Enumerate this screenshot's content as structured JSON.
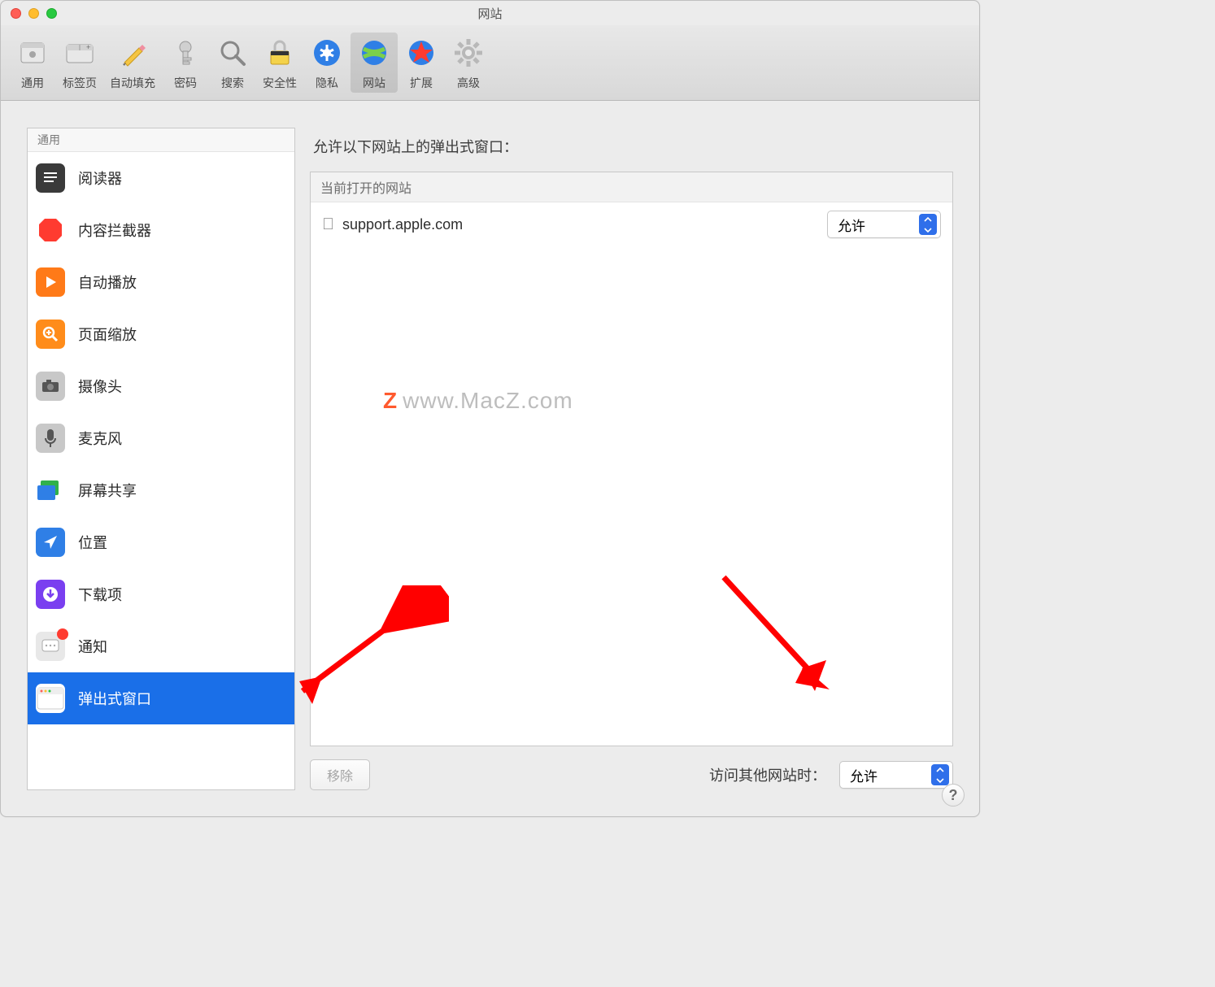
{
  "window": {
    "title": "网站"
  },
  "toolbar": {
    "items": [
      {
        "label": "通用",
        "icon": "general"
      },
      {
        "label": "标签页",
        "icon": "tabs"
      },
      {
        "label": "自动填充",
        "icon": "autofill"
      },
      {
        "label": "密码",
        "icon": "passwords"
      },
      {
        "label": "搜索",
        "icon": "search"
      },
      {
        "label": "安全性",
        "icon": "security"
      },
      {
        "label": "隐私",
        "icon": "privacy"
      },
      {
        "label": "网站",
        "icon": "websites",
        "selected": true
      },
      {
        "label": "扩展",
        "icon": "extensions"
      },
      {
        "label": "高级",
        "icon": "advanced"
      }
    ]
  },
  "sidebar": {
    "header": "通用",
    "items": [
      {
        "label": "阅读器",
        "icon": "reader"
      },
      {
        "label": "内容拦截器",
        "icon": "blocker"
      },
      {
        "label": "自动播放",
        "icon": "autoplay"
      },
      {
        "label": "页面缩放",
        "icon": "zoom"
      },
      {
        "label": "摄像头",
        "icon": "camera"
      },
      {
        "label": "麦克风",
        "icon": "mic"
      },
      {
        "label": "屏幕共享",
        "icon": "screenshare"
      },
      {
        "label": "位置",
        "icon": "location"
      },
      {
        "label": "下载项",
        "icon": "downloads"
      },
      {
        "label": "通知",
        "icon": "notifications",
        "badge": true
      },
      {
        "label": "弹出式窗口",
        "icon": "popup",
        "selected": true
      }
    ]
  },
  "main": {
    "title": "允许以下网站上的弹出式窗口：",
    "box_header": "当前打开的网站",
    "sites": [
      {
        "name": "support.apple.com",
        "value": "允许"
      }
    ],
    "remove_label": "移除",
    "other_label": "访问其他网站时：",
    "other_value": "允许"
  },
  "watermark": {
    "z": "Z",
    "text": "www.MacZ.com"
  },
  "help": "?"
}
